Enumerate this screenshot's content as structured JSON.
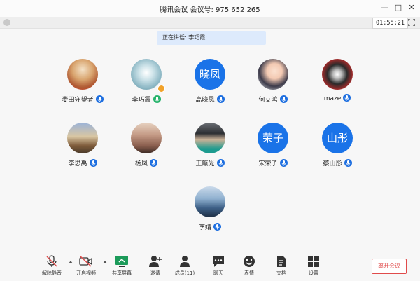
{
  "window": {
    "title": "腾讯会议  会议号: 975 652 265",
    "timer": "01:55:21"
  },
  "speaking_banner": "正在讲话: 李巧霞;",
  "participants": [
    {
      "name": "麦田守望者",
      "avatar_type": "photo",
      "mic": "blue"
    },
    {
      "name": "李巧霞",
      "avatar_type": "photo",
      "mic": "green",
      "host_badge": true
    },
    {
      "name": "高晓凤",
      "avatar_type": "text",
      "avatar_text": "晓凤",
      "mic": "blue"
    },
    {
      "name": "何艾鸿",
      "avatar_type": "photo",
      "mic": "blue"
    },
    {
      "name": "maze",
      "avatar_type": "photo",
      "mic": "blue"
    },
    {
      "name": "李思禹",
      "avatar_type": "photo",
      "mic": "blue"
    },
    {
      "name": "杨凤",
      "avatar_type": "photo",
      "mic": "blue"
    },
    {
      "name": "王甑光",
      "avatar_type": "photo",
      "mic": "blue"
    },
    {
      "name": "宋荣子",
      "avatar_type": "text",
      "avatar_text": "荣子",
      "mic": "blue"
    },
    {
      "name": "蔡山彤",
      "avatar_type": "text",
      "avatar_text": "山彤",
      "mic": "blue"
    },
    {
      "name": "李婧",
      "avatar_type": "photo",
      "mic": "blue"
    }
  ],
  "toolbar": [
    {
      "label": "解除静音",
      "icon": "mic-muted-icon"
    },
    {
      "label": "开启视频",
      "icon": "video-off-icon"
    },
    {
      "label": "共享屏幕",
      "icon": "share-screen-icon"
    },
    {
      "label": "邀请",
      "icon": "invite-icon"
    },
    {
      "label": "成员(11)",
      "icon": "members-icon"
    },
    {
      "label": "聊天",
      "icon": "chat-icon"
    },
    {
      "label": "表情",
      "icon": "emoji-icon"
    },
    {
      "label": "文档",
      "icon": "document-icon"
    },
    {
      "label": "设置",
      "icon": "settings-icon"
    }
  ],
  "leave_button": "离开会议",
  "colors": {
    "accent": "#1a73e8",
    "leave": "#e04b4b",
    "banner": "#ddeafc"
  }
}
